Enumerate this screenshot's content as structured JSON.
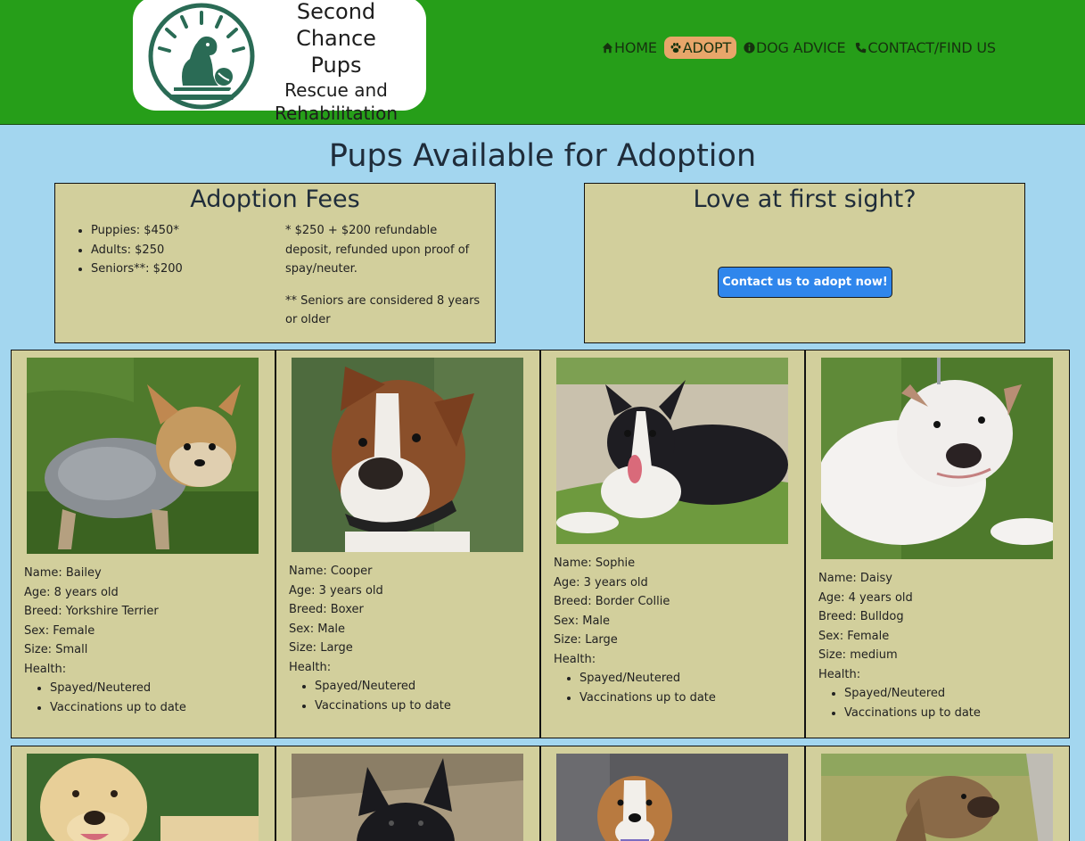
{
  "logo": {
    "line1": "Second Chance",
    "line2": "Pups",
    "line3": "Rescue and",
    "line4": "Rehabilitation"
  },
  "nav": [
    {
      "icon": "home-icon",
      "label": "HOME",
      "active": false
    },
    {
      "icon": "paw-icon",
      "label": "ADOPT",
      "active": true
    },
    {
      "icon": "info-icon",
      "label": "DOG ADVICE",
      "active": false
    },
    {
      "icon": "phone-icon",
      "label": "CONTACT/FIND US",
      "active": false
    }
  ],
  "page_title": "Pups Available for Adoption",
  "fees": {
    "title": "Adoption Fees",
    "items": [
      "Puppies: $450*",
      "Adults: $250",
      "Seniors**: $200"
    ],
    "note1": "* $250 + $200 refundable deposit, refunded upon proof of spay/neuter.",
    "note2": "** Seniors are considered 8 years or older"
  },
  "love": {
    "title": "Love at first sight?",
    "button": "Contact us to adopt now!"
  },
  "health_label": "Health:",
  "dogs": [
    {
      "name": "Name: Bailey",
      "age": "Age: 8 years old",
      "breed": "Breed: Yorkshire Terrier",
      "sex": "Sex: Female",
      "size": "Size: Small",
      "health": [
        "Spayed/Neutered",
        "Vaccinations up to date"
      ]
    },
    {
      "name": "Name: Cooper",
      "age": "Age: 3 years old",
      "breed": "Breed: Boxer",
      "sex": "Sex: Male",
      "size": "Size: Large",
      "health": [
        "Spayed/Neutered",
        "Vaccinations up to date"
      ]
    },
    {
      "name": "Name: Sophie",
      "age": "Age: 3 years old",
      "breed": "Breed: Border Collie",
      "sex": "Sex: Male",
      "size": "Size: Large",
      "health": [
        "Spayed/Neutered",
        "Vaccinations up to date"
      ]
    },
    {
      "name": "Name: Daisy",
      "age": "Age: 4 years old",
      "breed": "Breed: Bulldog",
      "sex": "Sex: Female",
      "size": "Size: medium",
      "health": [
        "Spayed/Neutered",
        "Vaccinations up to date"
      ]
    }
  ],
  "colors": {
    "header": "#269e19",
    "background": "#a3d6ef",
    "panel": "#d2cf9c",
    "active_nav": "#e8a66a",
    "button": "#2f86ec"
  }
}
